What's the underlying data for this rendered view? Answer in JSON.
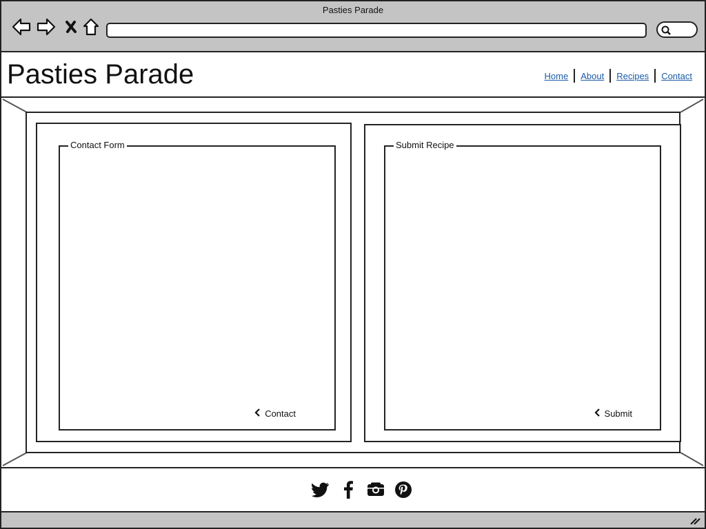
{
  "window": {
    "title": "Pasties Parade"
  },
  "toolbar": {
    "icons": [
      "back-arrow-icon",
      "forward-arrow-icon",
      "close-icon",
      "home-icon",
      "search-icon"
    ],
    "url_value": ""
  },
  "header": {
    "site_title": "Pasties Parade",
    "nav": [
      {
        "label": "Home"
      },
      {
        "label": "About"
      },
      {
        "label": "Recipes"
      },
      {
        "label": "Contact"
      }
    ],
    "link_color": "#1a5ba8"
  },
  "main": {
    "contact_form": {
      "legend": "Contact Form",
      "button_label": "Contact"
    },
    "submit_recipe": {
      "legend": "Submit Recipe",
      "button_label": "Submit"
    }
  },
  "footer": {
    "social_icons": [
      "twitter-icon",
      "facebook-icon",
      "instagram-icon",
      "pinterest-icon"
    ]
  },
  "colors": {
    "chrome_gray": "#c4c4c4",
    "stroke": "#222222"
  }
}
